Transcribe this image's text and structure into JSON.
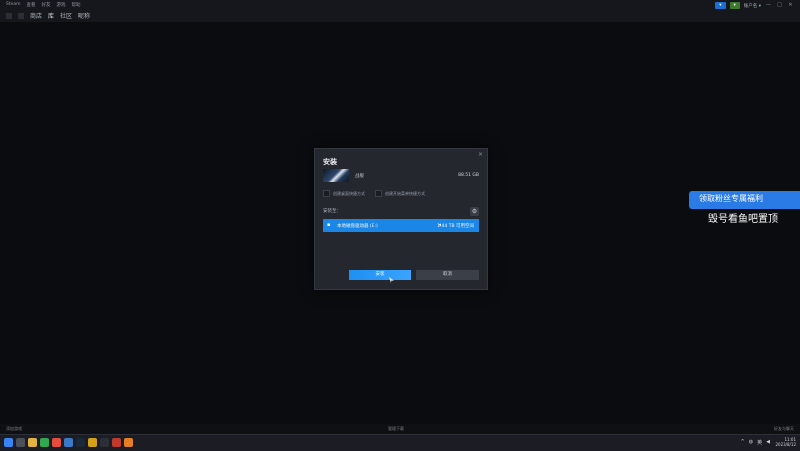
{
  "app": {
    "menu": [
      "Steam",
      "查看",
      "好友",
      "游戏",
      "帮助"
    ],
    "nav": {
      "items": [
        "商店",
        "库",
        "社区",
        "昵称"
      ],
      "active_index": 1
    },
    "right_pills": [
      "▾",
      "▾"
    ],
    "account_name": "账户名 ▾",
    "window_controls": [
      "—",
      "□",
      "✕"
    ]
  },
  "dialog": {
    "title": "安装",
    "close": "×",
    "game": {
      "name": "战舰",
      "size": "88.51 GB"
    },
    "options": [
      "创建桌面快捷方式",
      "创建开始菜单快捷方式"
    ],
    "section_label": "安装至：",
    "drive": {
      "name": "本地磁盘驱动器 (E:)",
      "free": "1.44 TB 可用空间"
    },
    "install_button": "安装",
    "cancel_button": "取消"
  },
  "overlay": {
    "banner": "领取粉丝专属福利",
    "text": "毁号看鱼吧置顶"
  },
  "statusbar": {
    "left": "添加游戏",
    "middle": "管理下载",
    "right": "好友与聊天"
  },
  "taskbar": {
    "tray_label": "英",
    "time": "11:01",
    "date": "2023/8/12"
  },
  "colors": {
    "accent": "#1a87e6",
    "dialog_bg": "#24272e",
    "banner": "#2a7be6"
  }
}
